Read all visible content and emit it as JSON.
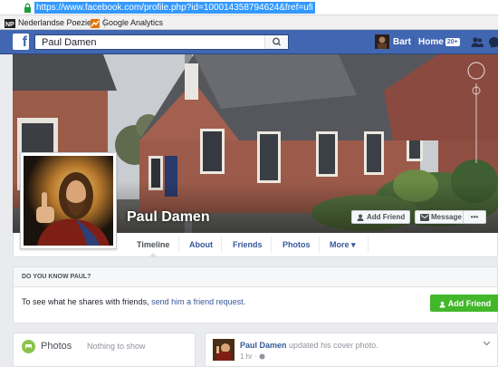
{
  "browser": {
    "url": "https://www.facebook.com/profile.php?id=100014358794624&fref=ufi",
    "bookmarks": [
      {
        "label": "Nederlandse Poezie S",
        "icon": "npp-icon"
      },
      {
        "label": "Google Analytics",
        "icon": "analytics-icon"
      }
    ]
  },
  "fbbar": {
    "logo": "f",
    "search_value": "Paul Damen",
    "user": "Bart",
    "home_label": "Home",
    "home_badge": "20+"
  },
  "profile": {
    "name": "Paul Damen",
    "add_friend_label": "Add Friend",
    "message_label": "Message",
    "more_label": "•••"
  },
  "timeline_tabs": [
    {
      "label": "Timeline"
    },
    {
      "label": "About"
    },
    {
      "label": "Friends"
    },
    {
      "label": "Photos"
    },
    {
      "label": "More ▾"
    }
  ],
  "know_box": {
    "heading": "DO YOU KNOW PAUL?",
    "text_prefix": "To see what he shares with friends,",
    "link_text": "send him a friend request.",
    "button_label": "Add Friend"
  },
  "photos_box": {
    "title": "Photos",
    "subtitle": "Nothing to show"
  },
  "post": {
    "author": "Paul Damen",
    "action": "updated his cover photo.",
    "time": "1 hr ·"
  },
  "colors": {
    "fb_blue": "#4267b2",
    "link": "#365899",
    "green": "#42b72a"
  }
}
